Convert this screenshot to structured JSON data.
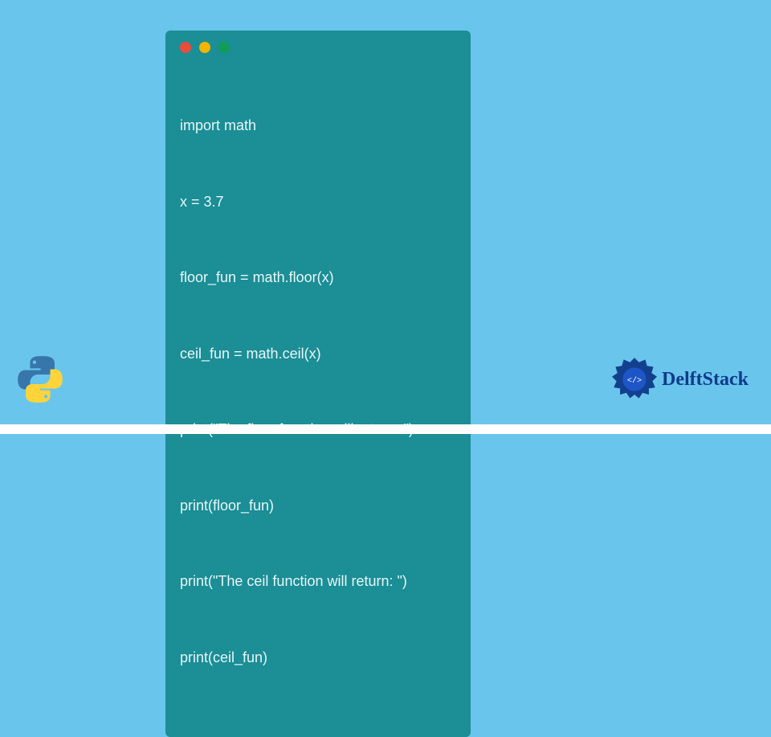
{
  "code": {
    "lines": [
      "import math",
      "x = 3.7",
      "floor_fun = math.floor(x)",
      "ceil_fun = math.ceil(x)",
      "print(\"The floor function will return: \")",
      "print(floor_fun)",
      "print(\"The ceil function will return: \")",
      "print(ceil_fun)"
    ]
  },
  "brand": {
    "name": "DelftStack"
  },
  "colors": {
    "page_bg": "#6ac5ec",
    "window_bg": "#1b8e96",
    "code_text": "#e8f6f7",
    "brand_text": "#0d3b8c",
    "dot_red": "#e94b3c",
    "dot_yellow": "#f4b400",
    "dot_green": "#0f9d58"
  },
  "icons": {
    "python": "python-logo",
    "delft_badge": "delft-badge-icon"
  }
}
